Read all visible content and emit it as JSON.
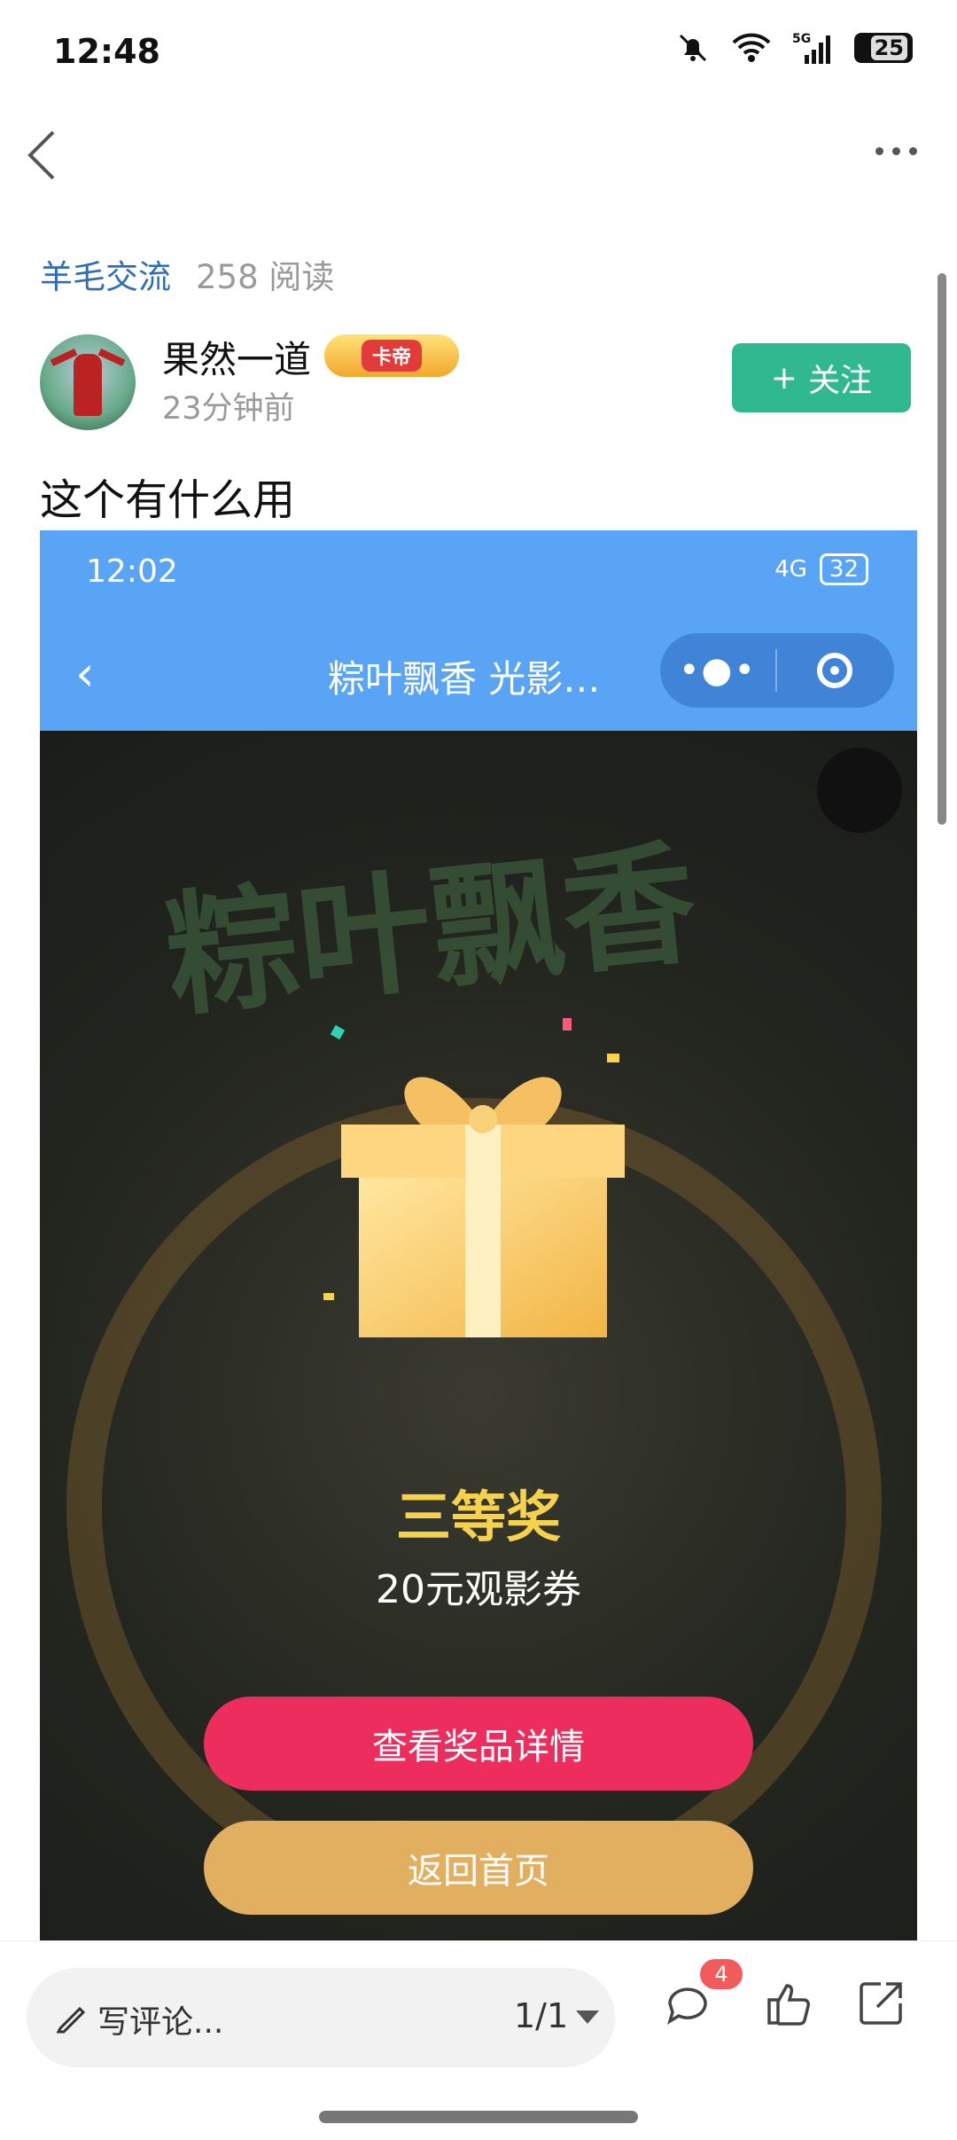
{
  "status_bar": {
    "time": "12:48",
    "battery": "25",
    "network": "5G"
  },
  "post": {
    "category": "羊毛交流",
    "reads": "258 阅读",
    "author": "果然一道",
    "author_badge": "卡帝",
    "time_ago": "23分钟前",
    "follow_label": "关注",
    "title": "这个有什么用"
  },
  "embedded_screenshot": {
    "time": "12:02",
    "battery": "32",
    "network": "4G",
    "title": "粽叶飘香 光影…",
    "bg_title": "粽叶飘香",
    "prize_level": "三等奖",
    "prize_desc": "20元观影券",
    "button_details": "查看奖品详情",
    "button_home": "返回首页"
  },
  "bottom_bar": {
    "comment_placeholder": "写评论...",
    "pager": "1/1",
    "comment_count": "4"
  },
  "colors": {
    "follow": "#30b991",
    "category": "#2f6db5",
    "pink_button": "#ec2d5e",
    "gold_button": "#e2ae60",
    "prize_yellow": "#f6d24c"
  }
}
